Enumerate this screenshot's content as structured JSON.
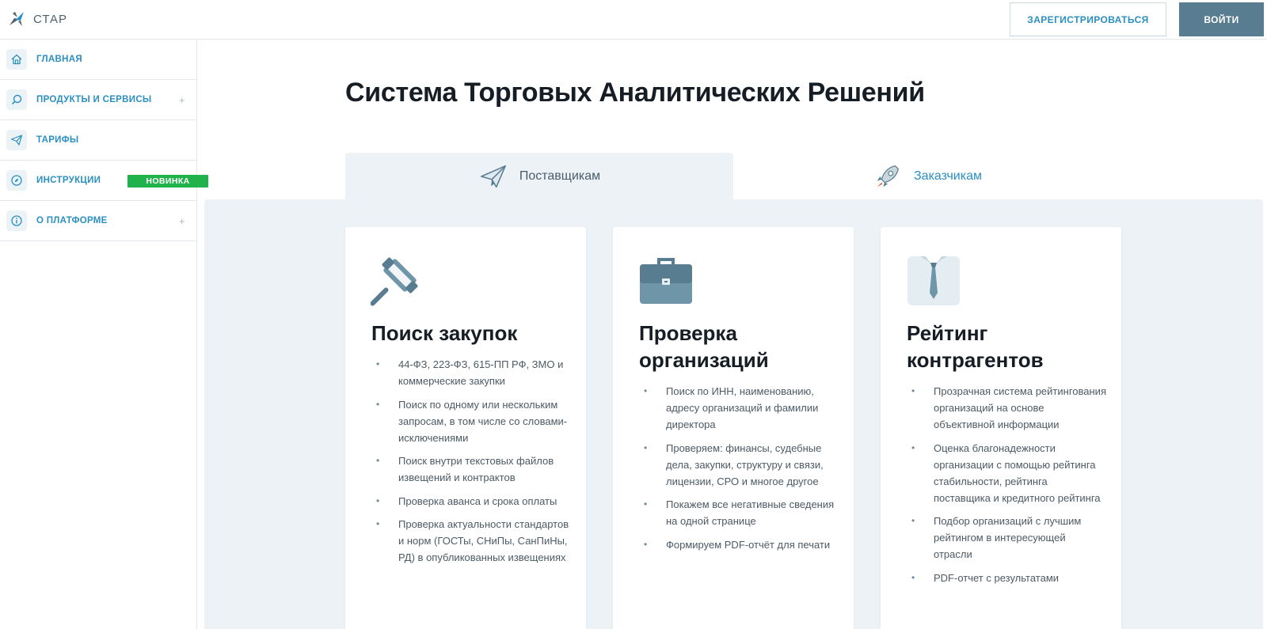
{
  "header": {
    "logo_text": "СТАР",
    "register_label": "ЗАРЕГИСТРИРОВАТЬСЯ",
    "login_label": "ВОЙТИ"
  },
  "sidebar": {
    "items": [
      {
        "label": "ГЛАВНАЯ",
        "icon": "home-icon"
      },
      {
        "label": "ПРОДУКТЫ И СЕРВИСЫ",
        "icon": "search-icon",
        "expandable": true
      },
      {
        "label": "ТАРИФЫ",
        "icon": "paper-plane-icon"
      },
      {
        "label": "ИНСТРУКЦИИ",
        "icon": "compass-icon",
        "badge": "НОВИНКА"
      },
      {
        "label": "О ПЛАТФОРМЕ",
        "icon": "info-icon",
        "expandable": true
      }
    ],
    "plus_symbol": "+"
  },
  "main": {
    "title": "Система Торговых Аналитических Решений",
    "tabs": [
      {
        "label": "Поставщикам",
        "icon": "paper-plane-icon",
        "active": true
      },
      {
        "label": "Заказчикам",
        "icon": "rocket-icon",
        "active": false
      }
    ],
    "cards": [
      {
        "title": "Поиск закупок",
        "icon": "gavel-icon",
        "items": [
          "44-ФЗ, 223-ФЗ, 615-ПП РФ, ЗМО и коммерческие закупки",
          "Поиск по одному или нескольким запросам, в том числе со словами-исключениями",
          "Поиск внутри текстовых файлов извещений и контрактов",
          "Проверка аванса и срока оплаты",
          "Проверка актуальности стандартов и норм (ГОСТы, СНиПы, СанПиНы, РД) в опубликованных извещениях"
        ]
      },
      {
        "title": "Проверка организаций",
        "icon": "briefcase-icon",
        "items": [
          "Поиск по ИНН, наименованию, адресу организаций и фамилии директора",
          "Проверяем: финансы, судебные дела, закупки, структуру и связи, лицензии, СРО и многое другое",
          "Покажем все негативные сведения на одной странице",
          "Формируем PDF-отчёт для печати"
        ]
      },
      {
        "title": "Рейтинг контрагентов",
        "icon": "shirt-tie-icon",
        "items": [
          "Прозрачная система рейтингования организаций на основе объективной информации",
          "Оценка благонадежности организации с помощью рейтинга стабильности, рейтинга поставщика и кредитного рейтинга",
          "Подбор организаций с лучшим рейтингом в интересующей отрасли",
          "PDF-отчет с результатами"
        ]
      }
    ]
  },
  "colors": {
    "accent": "#2a8fc1",
    "login_bg": "#587d90",
    "badge_bg": "#22b24c",
    "panel_bg": "#ecf2f5"
  }
}
